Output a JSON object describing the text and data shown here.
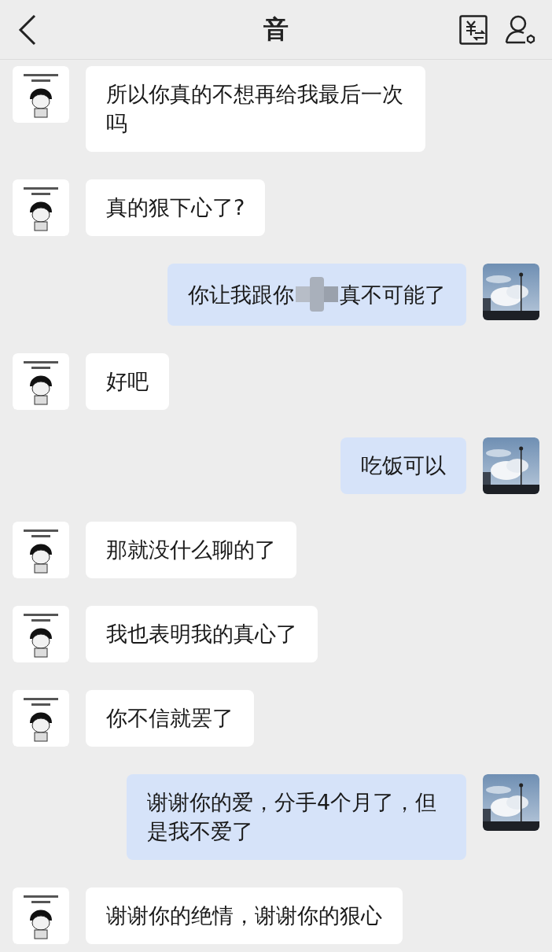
{
  "header": {
    "title": "音"
  },
  "messages": [
    {
      "from_me": false,
      "kind": "text",
      "text": "所以你真的不想再给我最后一次吗"
    },
    {
      "from_me": false,
      "kind": "text",
      "text": "真的狠下心了?"
    },
    {
      "from_me": true,
      "kind": "redacted",
      "before": "你让我跟你",
      "after": "真不可能了"
    },
    {
      "from_me": false,
      "kind": "text",
      "text": "好吧"
    },
    {
      "from_me": true,
      "kind": "text",
      "text": "吃饭可以"
    },
    {
      "from_me": false,
      "kind": "text",
      "text": "那就没什么聊的了"
    },
    {
      "from_me": false,
      "kind": "text",
      "text": "我也表明我的真心了"
    },
    {
      "from_me": false,
      "kind": "text",
      "text": "你不信就罢了"
    },
    {
      "from_me": true,
      "kind": "text",
      "text": "谢谢你的爱，分手4个月了，但是我不爱了"
    },
    {
      "from_me": false,
      "kind": "text",
      "text": "谢谢你的绝情，谢谢你的狠心"
    }
  ]
}
